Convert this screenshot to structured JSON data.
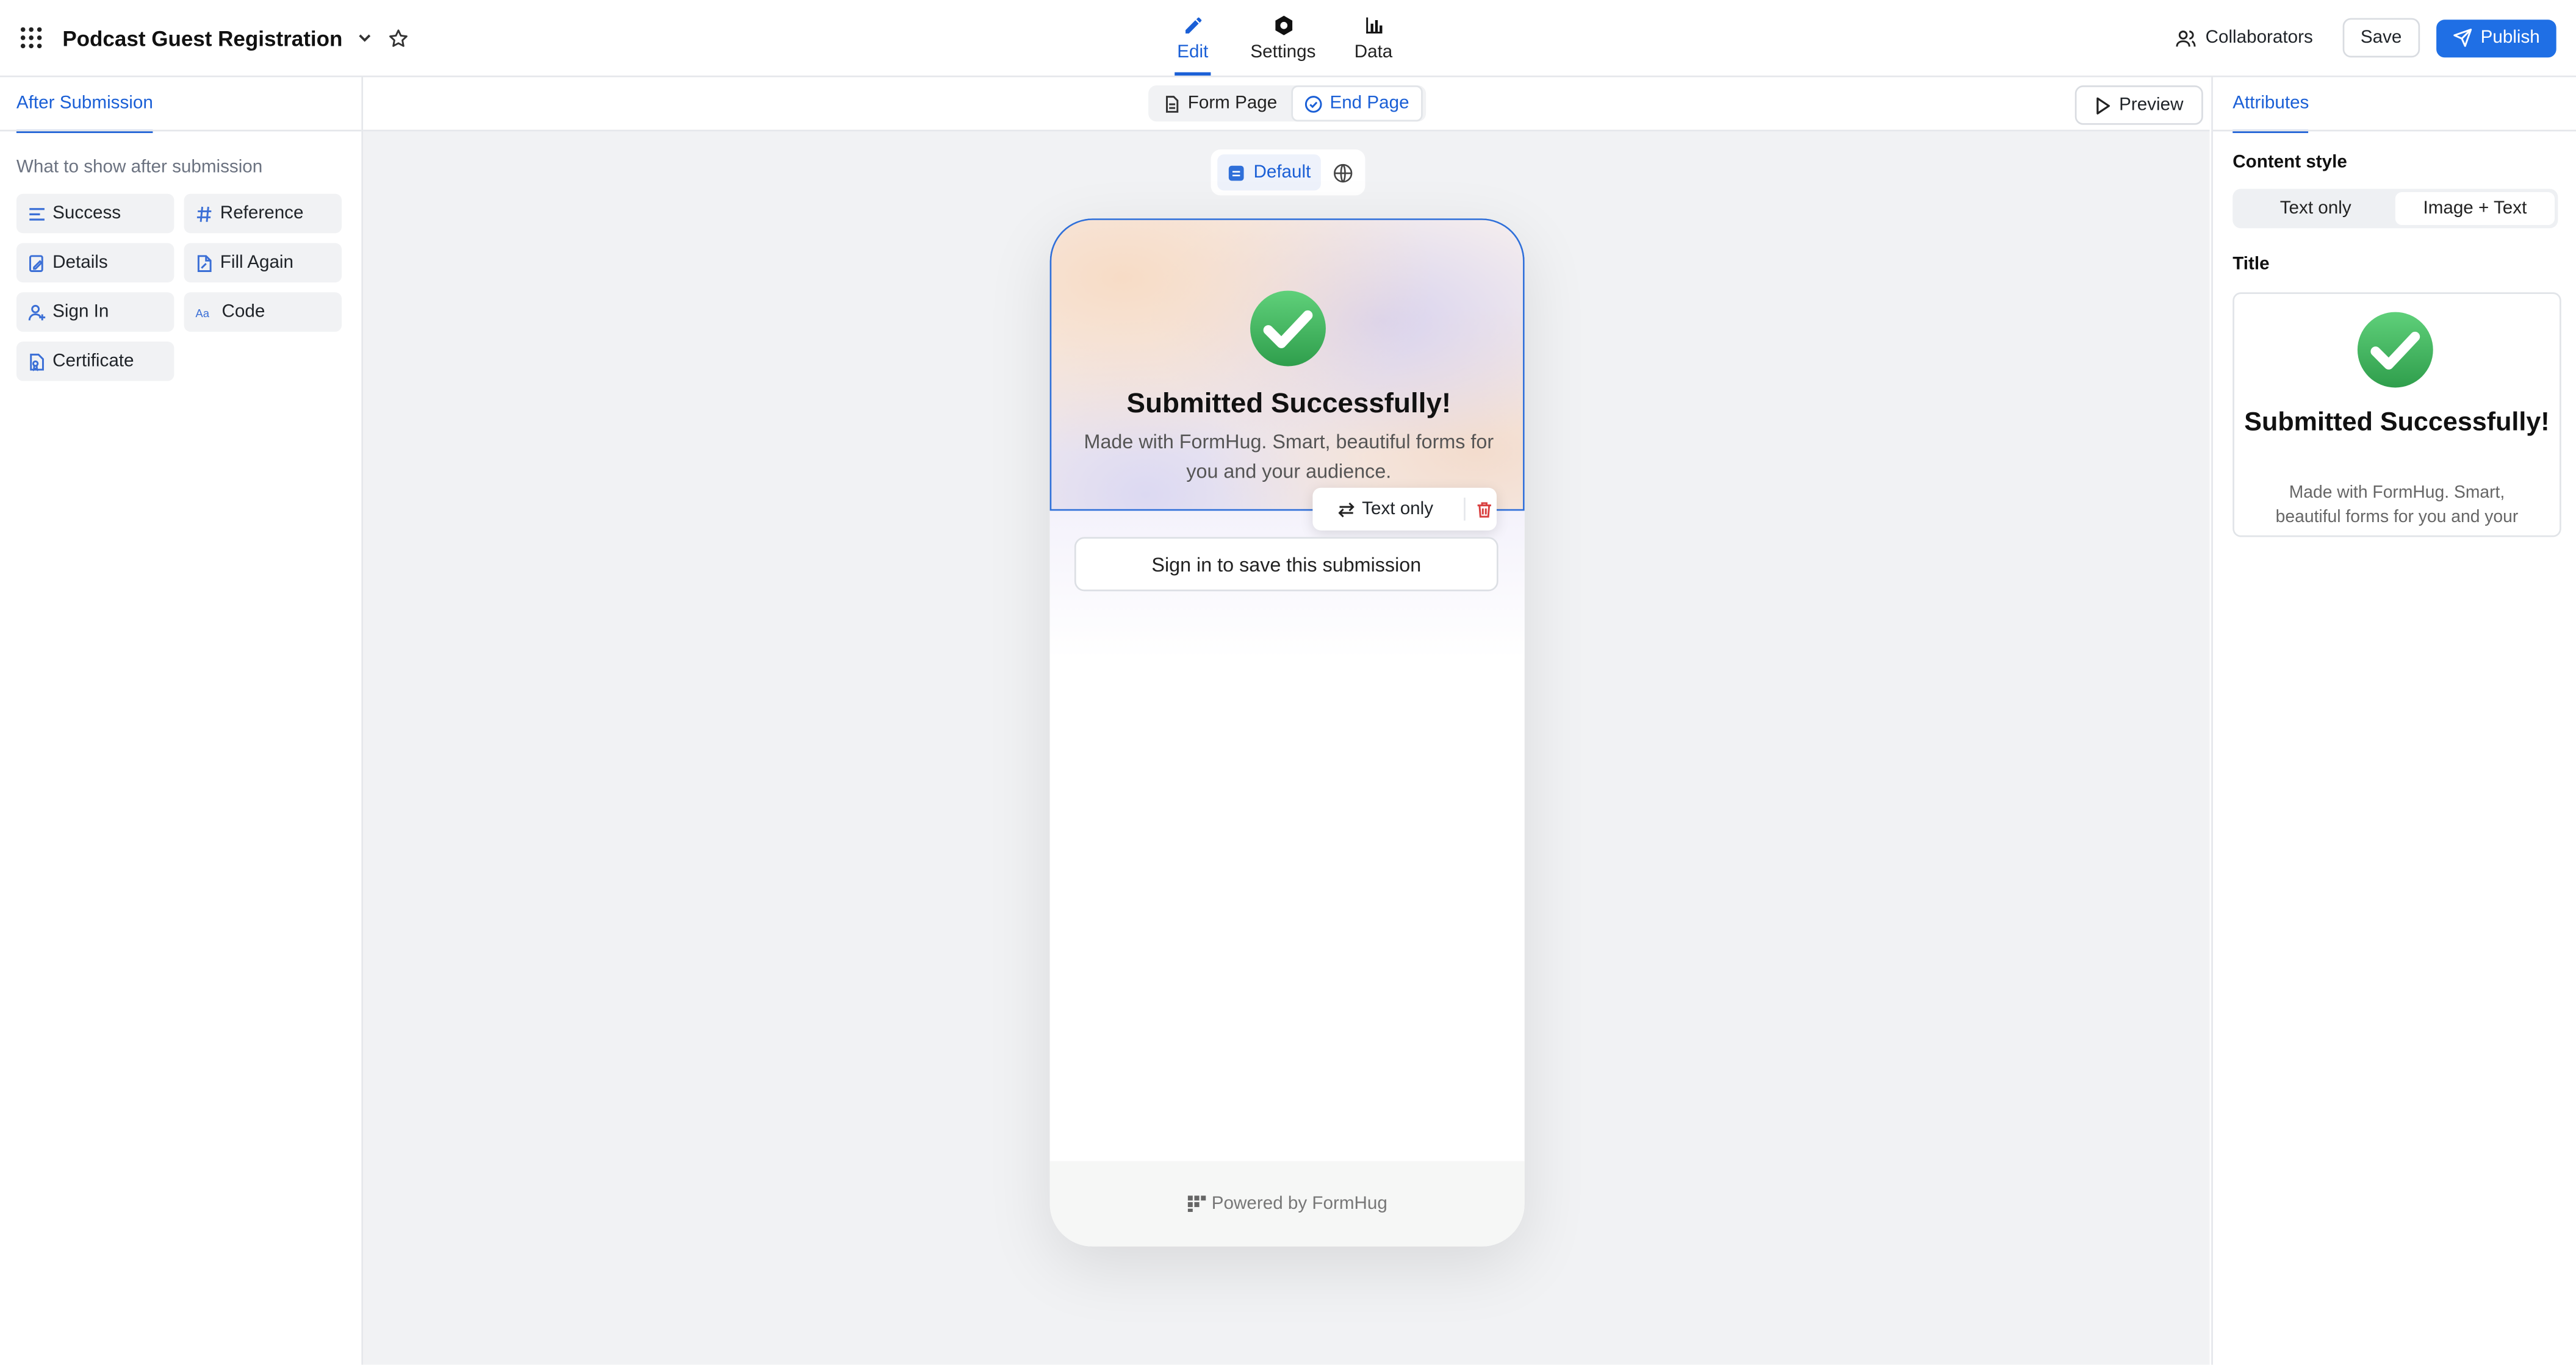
{
  "header": {
    "form_title": "Podcast Guest Registration",
    "tabs": [
      {
        "label": "Edit"
      },
      {
        "label": "Settings"
      },
      {
        "label": "Data"
      }
    ],
    "collaborators_label": "Collaborators",
    "save_label": "Save",
    "publish_label": "Publish",
    "active_tab": "Edit"
  },
  "left_panel": {
    "tab_label": "After Submission",
    "subtitle": "What to show after submission",
    "items": [
      {
        "label": "Success",
        "icon": "lines-icon"
      },
      {
        "label": "Reference",
        "icon": "hash-icon"
      },
      {
        "label": "Details",
        "icon": "document-edit-icon"
      },
      {
        "label": "Fill Again",
        "icon": "document-pen-icon"
      },
      {
        "label": "Sign In",
        "icon": "user-plus-icon"
      },
      {
        "label": "Code",
        "icon": "text-code-icon"
      },
      {
        "label": "Certificate",
        "icon": "certificate-icon"
      }
    ]
  },
  "canvas": {
    "page_tabs": [
      {
        "label": "Form Page"
      },
      {
        "label": "End Page"
      }
    ],
    "active_page_tab": "End Page",
    "preview_label": "Preview",
    "language_default_label": "Default",
    "hero": {
      "title": "Submitted Successfully!",
      "description": "Made with FormHug. Smart, beautiful forms for you and your audience."
    },
    "toolbar": {
      "switch_label": "Text only"
    },
    "signin_button_label": "Sign in to save this submission",
    "footer_label": "Powered by FormHug"
  },
  "right_panel": {
    "tab_label": "Attributes",
    "content_style_label": "Content style",
    "content_style_options": [
      {
        "label": "Text only"
      },
      {
        "label": "Image + Text"
      }
    ],
    "content_style_selected": "Image + Text",
    "title_label": "Title",
    "title_preview": {
      "title": "Submitted Successfully!",
      "description": "Made with FormHug. Smart, beautiful forms for you and your"
    }
  },
  "colors": {
    "accent": "#1f6fe5",
    "success": "#3cb55e",
    "danger": "#d94040",
    "canvas_bg": "#f1f2f4"
  }
}
